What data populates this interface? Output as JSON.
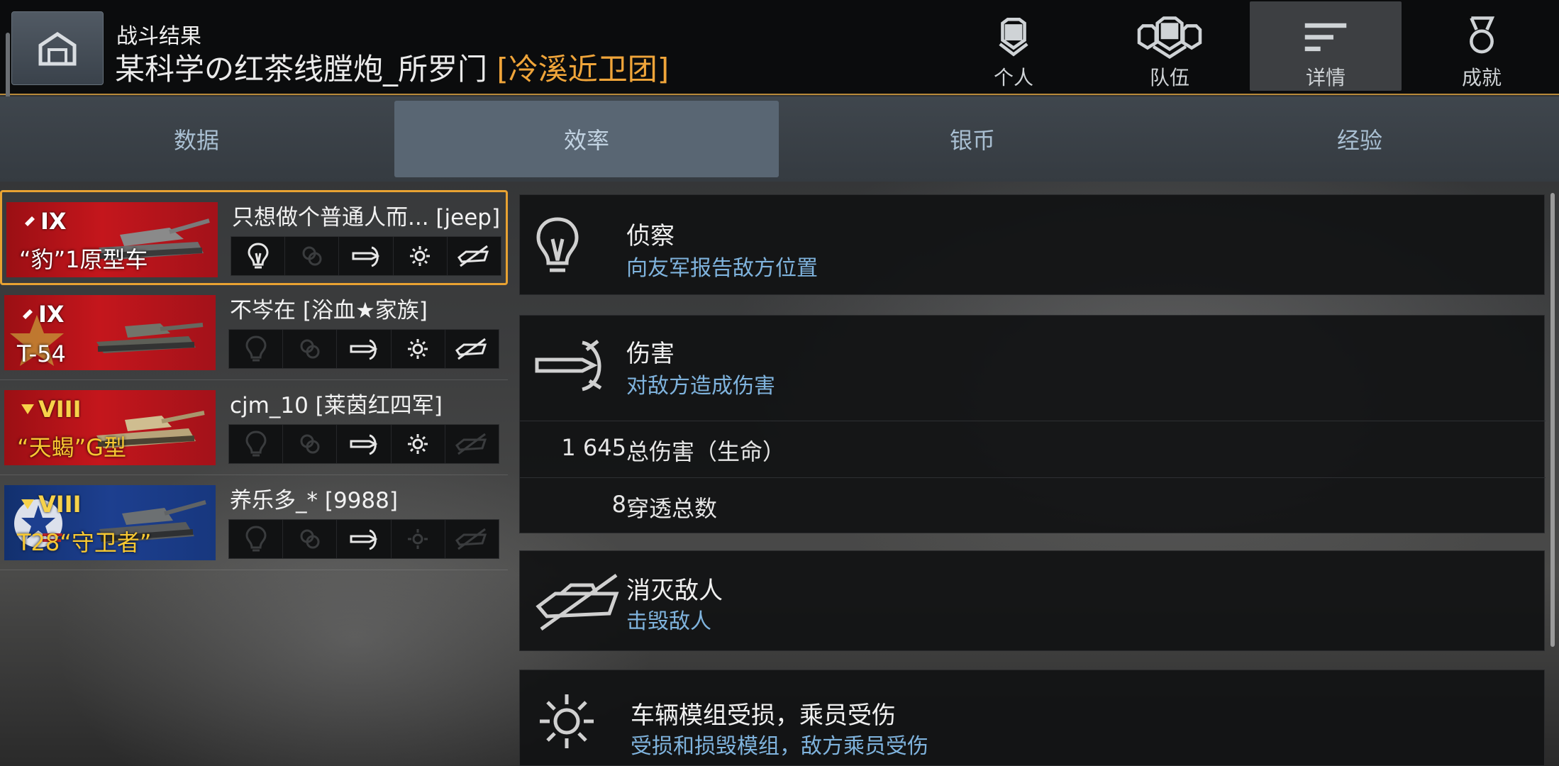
{
  "header": {
    "subtitle": "战斗结果",
    "player_name": "某科学の红茶线膛炮_所罗门",
    "clan_tag": "[冷溪近卫团]",
    "nav": [
      {
        "label": "个人",
        "icon": "personal-icon"
      },
      {
        "label": "队伍",
        "icon": "team-icon"
      },
      {
        "label": "详情",
        "icon": "details-icon"
      },
      {
        "label": "成就",
        "icon": "medal-icon"
      }
    ],
    "active_nav": "详情"
  },
  "tabs": [
    "数据",
    "效率",
    "银币",
    "经验"
  ],
  "active_tab": "效率",
  "players": [
    {
      "tier": "IX",
      "vehicle": "“豹”1原型车",
      "name": "只想做个普通人而... [jeep]",
      "banner": "red",
      "icons_on": [
        true,
        false,
        true,
        true,
        true
      ]
    },
    {
      "tier": "IX",
      "vehicle": "T-54",
      "name": "不岑在 [浴血★家族]",
      "banner": "red",
      "icons_on": [
        false,
        false,
        true,
        true,
        true
      ]
    },
    {
      "tier": "VIII",
      "vehicle": "“天蝎”G型",
      "name": "cjm_10 [莱茵红四军]",
      "banner": "red",
      "icons_on": [
        false,
        false,
        true,
        true,
        false
      ]
    },
    {
      "tier": "VIII",
      "vehicle": "T28“守卫者”",
      "name": "养乐多_* [9988]",
      "banner": "blue",
      "icons_on": [
        false,
        false,
        true,
        false,
        false
      ]
    }
  ],
  "details": {
    "spotting": {
      "title": "侦察",
      "subtitle": "向友军报告敌方位置"
    },
    "damage": {
      "title": "伤害",
      "subtitle": "对敌方造成伤害",
      "stats": [
        {
          "value": "1 645",
          "label": "总伤害（生命）"
        },
        {
          "value": "8",
          "label": "穿透总数"
        }
      ]
    },
    "destroyed": {
      "title": "消灭敌人",
      "subtitle": "击毁敌人"
    },
    "modules": {
      "title": "车辆模组受损，乘员受伤",
      "subtitle": "受损和损毁模组，敌方乘员受伤"
    }
  },
  "colors": {
    "accent": "#e8a232",
    "clan": "#f0a53a",
    "subtitle_blue": "#7fb3dd"
  }
}
